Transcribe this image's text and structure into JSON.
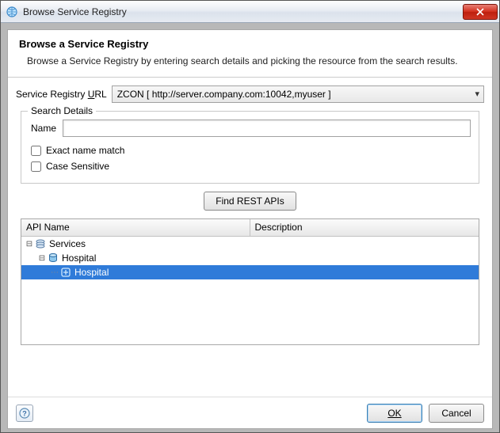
{
  "window": {
    "title": "Browse Service Registry"
  },
  "header": {
    "title": "Browse a Service Registry",
    "description": "Browse a Service Registry by entering search details and picking the resource from the search results."
  },
  "url_row": {
    "label_prefix": "Service Registry ",
    "label_key": "U",
    "label_suffix": "RL",
    "selected": "ZCON [ http://server.company.com:10042,myuser ]"
  },
  "search_details": {
    "legend": "Search Details",
    "name_label": "Name",
    "name_value": "",
    "exact_match_label": "Exact name match",
    "exact_match_checked": false,
    "case_sensitive_label": "Case Sensitive",
    "case_sensitive_checked": false
  },
  "find_button": "Find REST APIs",
  "table": {
    "columns": {
      "api": "API Name",
      "desc": "Description"
    },
    "tree": [
      {
        "level": 0,
        "expanded": true,
        "icon": "stack",
        "label": "Services",
        "selected": false
      },
      {
        "level": 1,
        "expanded": true,
        "icon": "db",
        "label": "Hospital",
        "selected": false
      },
      {
        "level": 2,
        "expanded": false,
        "icon": "leaf",
        "label": "Hospital",
        "selected": true
      }
    ]
  },
  "footer": {
    "help": "?",
    "ok": "OK",
    "cancel": "Cancel"
  }
}
